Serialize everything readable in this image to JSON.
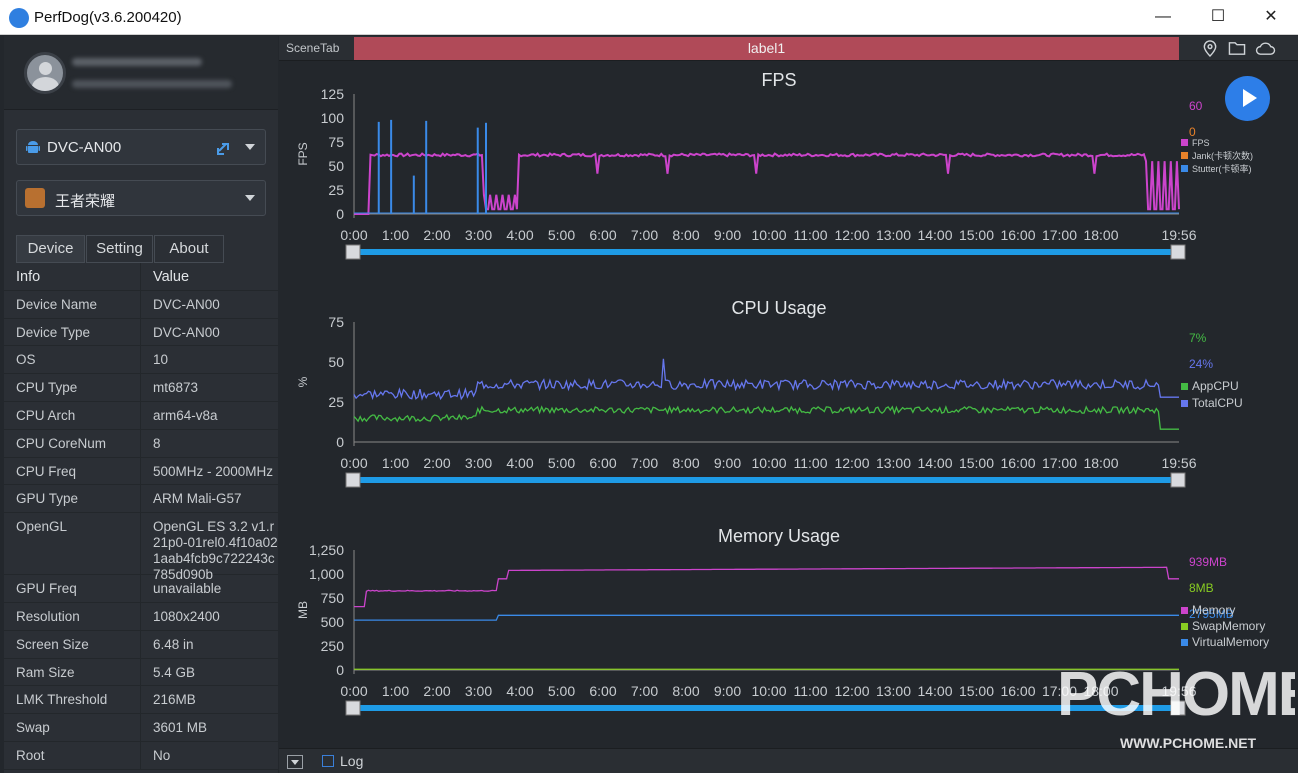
{
  "window": {
    "title": "PerfDog(v3.6.200420)",
    "minimize": "—",
    "maximize": "☐",
    "close": "✕"
  },
  "sidebar": {
    "device_select": {
      "value": "DVC-AN00",
      "icon": "android-icon"
    },
    "app_select": {
      "value": "王者荣耀",
      "icon": "game-icon"
    },
    "tabs": [
      "Device",
      "Setting",
      "About"
    ],
    "table_header": {
      "key": "Info",
      "value": "Value"
    },
    "rows": [
      {
        "key": "Device Name",
        "value": "DVC-AN00"
      },
      {
        "key": "Device Type",
        "value": "DVC-AN00"
      },
      {
        "key": "OS",
        "value": "10"
      },
      {
        "key": "CPU Type",
        "value": "mt6873"
      },
      {
        "key": "CPU Arch",
        "value": "arm64-v8a"
      },
      {
        "key": "CPU CoreNum",
        "value": "8"
      },
      {
        "key": "CPU Freq",
        "value": "500MHz - 2000MHz"
      },
      {
        "key": "GPU Type",
        "value": "ARM Mali-G57"
      },
      {
        "key": "OpenGL",
        "value": "OpenGL ES 3.2 v1.r21p0-01rel0.4f10a021aab4fcb9c722243c785d090b"
      },
      {
        "key": "GPU Freq",
        "value": "unavailable"
      },
      {
        "key": "Resolution",
        "value": "1080x2400"
      },
      {
        "key": "Screen Size",
        "value": "6.48 in"
      },
      {
        "key": "Ram Size",
        "value": "5.4 GB"
      },
      {
        "key": "LMK Threshold",
        "value": "216MB"
      },
      {
        "key": "Swap",
        "value": "3601 MB"
      },
      {
        "key": "Root",
        "value": "No"
      }
    ]
  },
  "topbar": {
    "scene_tab": "SceneTab",
    "label": "label1",
    "icons": [
      "location-icon",
      "folder-icon",
      "cloud-icon"
    ]
  },
  "bottombar": {
    "log_label": "Log"
  },
  "watermark": {
    "text": "PCHOME",
    "url": "WWW.PCHOME.NET"
  },
  "chart_data": [
    {
      "type": "line",
      "title": "FPS",
      "ylabel": "FPS",
      "ylim": [
        0,
        125
      ],
      "yticks": [
        "0",
        "25",
        "50",
        "75",
        "100",
        "125"
      ],
      "xticks": [
        "0:00",
        "1:00",
        "2:00",
        "3:00",
        "4:00",
        "5:00",
        "6:00",
        "7:00",
        "8:00",
        "9:00",
        "10:00",
        "11:00",
        "12:00",
        "13:00",
        "14:00",
        "15:00",
        "16:00",
        "17:00",
        "18:00",
        "19:56"
      ],
      "current": [
        {
          "value": "60",
          "color": "#cc44cc"
        },
        {
          "value": "0",
          "color": "#e8822a"
        }
      ],
      "series": [
        {
          "name": "FPS",
          "color": "#cc44cc"
        },
        {
          "name": "Jank(卡顿次数)",
          "color": "#e8822a"
        },
        {
          "name": "Stutter(卡顿率)",
          "color": "#3a8ae8"
        }
      ]
    },
    {
      "type": "line",
      "title": "CPU Usage",
      "ylabel": "%",
      "ylim": [
        0,
        75
      ],
      "yticks": [
        "0",
        "25",
        "50",
        "75"
      ],
      "xticks": [
        "0:00",
        "1:00",
        "2:00",
        "3:00",
        "4:00",
        "5:00",
        "6:00",
        "7:00",
        "8:00",
        "9:00",
        "10:00",
        "11:00",
        "12:00",
        "13:00",
        "14:00",
        "15:00",
        "16:00",
        "17:00",
        "18:00",
        "19:56"
      ],
      "current": [
        {
          "value": "7%",
          "color": "#44bb44"
        },
        {
          "value": "24%",
          "color": "#6677ee"
        }
      ],
      "series": [
        {
          "name": "AppCPU",
          "color": "#44bb44"
        },
        {
          "name": "TotalCPU",
          "color": "#6677ee"
        }
      ]
    },
    {
      "type": "line",
      "title": "Memory Usage",
      "ylabel": "MB",
      "ylim": [
        0,
        1250
      ],
      "yticks": [
        "0",
        "250",
        "500",
        "750",
        "1,000",
        "1,250"
      ],
      "xticks": [
        "0:00",
        "1:00",
        "2:00",
        "3:00",
        "4:00",
        "5:00",
        "6:00",
        "7:00",
        "8:00",
        "9:00",
        "10:00",
        "11:00",
        "12:00",
        "13:00",
        "14:00",
        "15:00",
        "16:00",
        "17:00",
        "18:00",
        "19:56"
      ],
      "current": [
        {
          "value": "939MB",
          "color": "#cc44cc"
        },
        {
          "value": "8MB",
          "color": "#88cc22"
        },
        {
          "value": "2795MB",
          "color": "#3a8ae8"
        }
      ],
      "series": [
        {
          "name": "Memory",
          "color": "#cc44cc"
        },
        {
          "name": "SwapMemory",
          "color": "#88cc22"
        },
        {
          "name": "VirtualMemory",
          "color": "#3a8ae8"
        }
      ]
    }
  ]
}
